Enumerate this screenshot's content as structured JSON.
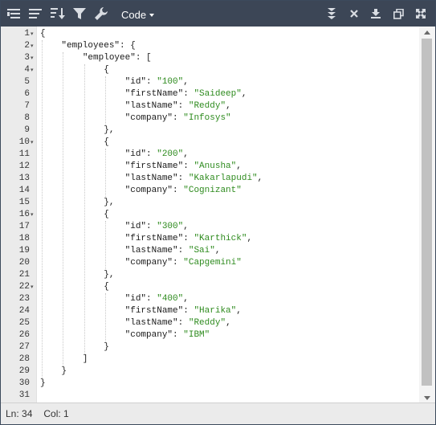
{
  "toolbar": {
    "mode_label": "Code",
    "icons": [
      "format-icon",
      "compact-icon",
      "sort-icon",
      "filter-icon",
      "repair-icon",
      "transform-icon",
      "collapse-all-icon",
      "clear-icon",
      "download-icon",
      "copy-icon",
      "fullscreen-icon"
    ]
  },
  "editor": {
    "line_numbers": [
      "1",
      "2",
      "3",
      "4",
      "5",
      "6",
      "7",
      "8",
      "9",
      "10",
      "11",
      "12",
      "13",
      "14",
      "15",
      "16",
      "17",
      "18",
      "19",
      "20",
      "21",
      "22",
      "23",
      "24",
      "25",
      "26",
      "27",
      "28",
      "29",
      "30",
      "31"
    ],
    "fold_lines": [
      1,
      2,
      3,
      4,
      10,
      16,
      22
    ],
    "lines": [
      "{",
      "    \"employees\": {",
      "        \"employee\": [",
      "            {",
      "                \"id\": \"100\",",
      "                \"firstName\": \"Saideep\",",
      "                \"lastName\": \"Reddy\",",
      "                \"company\": \"Infosys\"",
      "            },",
      "            {",
      "                \"id\": \"200\",",
      "                \"firstName\": \"Anusha\",",
      "                \"lastName\": \"Kakarlapudi\",",
      "                \"company\": \"Cognizant\"",
      "            },",
      "            {",
      "                \"id\": \"300\",",
      "                \"firstName\": \"Karthick\",",
      "                \"lastName\": \"Sai\",",
      "                \"company\": \"Capgemini\"",
      "            },",
      "            {",
      "                \"id\": \"400\",",
      "                \"firstName\": \"Harika\",",
      "                \"lastName\": \"Reddy\",",
      "                \"company\": \"IBM\"",
      "            }",
      "        ]",
      "    }",
      "}",
      ""
    ]
  },
  "status": {
    "line_label": "Ln: 34",
    "col_label": "Col: 1"
  },
  "colors": {
    "toolbar_bg": "#3c4656",
    "string": "#2e8b1e",
    "gutter_bg": "#ebebeb"
  }
}
